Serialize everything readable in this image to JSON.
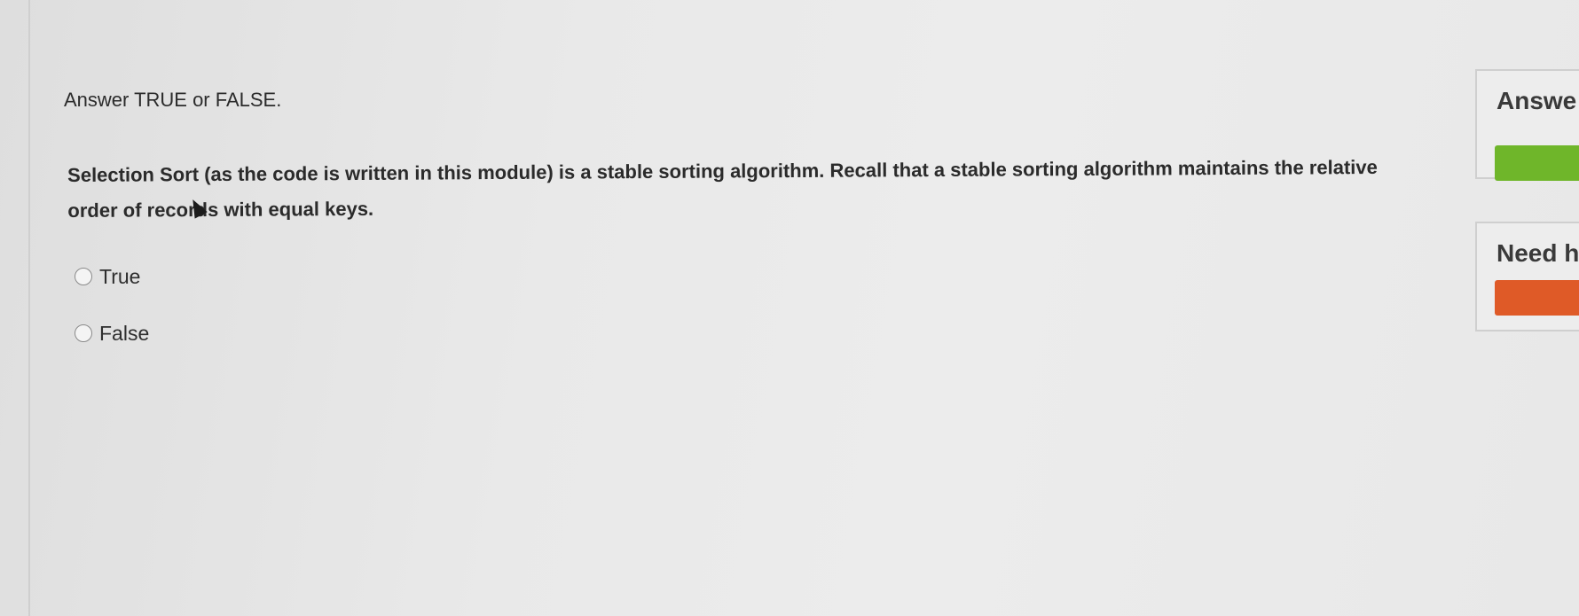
{
  "question": {
    "instruction": "Answer TRUE or FALSE.",
    "prompt": "Selection Sort (as the code is written in this module) is a stable sorting algorithm. Recall that a stable sorting algorithm maintains the relative order of records with equal keys.",
    "options": [
      {
        "label": "True",
        "selected": false
      },
      {
        "label": "False",
        "selected": false
      }
    ]
  },
  "sidebar": {
    "answer_title": "Answe",
    "help_title": "Need h"
  },
  "colors": {
    "answer_button": "#6fb62a",
    "help_button": "#df5a27"
  }
}
